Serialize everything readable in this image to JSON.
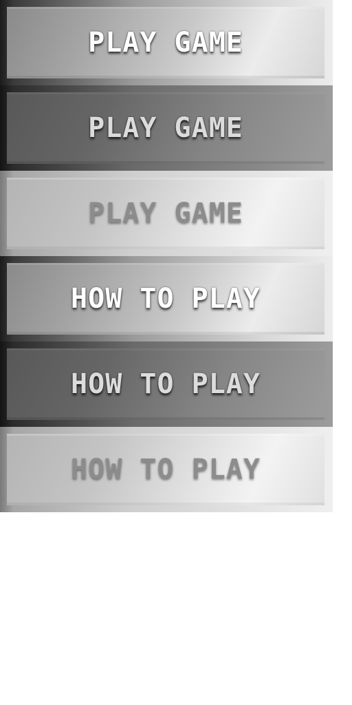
{
  "buttons": [
    {
      "label": "PLAY GAME",
      "state": "normal"
    },
    {
      "label": "PLAY GAME",
      "state": "hover"
    },
    {
      "label": "PLAY GAME",
      "state": "pressed"
    },
    {
      "label": "HOW TO PLAY",
      "state": "normal"
    },
    {
      "label": "HOW TO PLAY",
      "state": "hover"
    },
    {
      "label": "HOW TO PLAY",
      "state": "pressed"
    }
  ],
  "colors": {
    "background": "#ffffff",
    "label_normal": "#ffffff",
    "label_hover": "#dcdcdc",
    "label_pressed": "#8c8c8c"
  }
}
